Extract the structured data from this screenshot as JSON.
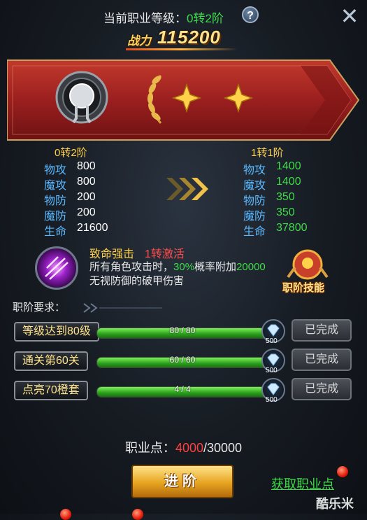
{
  "header": {
    "title_prefix": "当前职业等级：",
    "title_stage": "0转2阶",
    "power_label": "战力",
    "power_value": "115200"
  },
  "stats": {
    "current": {
      "stage": "0转2阶",
      "rows": [
        {
          "label": "物攻",
          "value": "800"
        },
        {
          "label": "魔攻",
          "value": "800"
        },
        {
          "label": "物防",
          "value": "200"
        },
        {
          "label": "魔防",
          "value": "200"
        },
        {
          "label": "生命",
          "value": "21600"
        }
      ]
    },
    "next": {
      "stage": "1转1阶",
      "rows": [
        {
          "label": "物攻",
          "value": "1400"
        },
        {
          "label": "魔攻",
          "value": "1400"
        },
        {
          "label": "物防",
          "value": "350"
        },
        {
          "label": "魔防",
          "value": "350"
        },
        {
          "label": "生命",
          "value": "37800"
        }
      ]
    }
  },
  "skill": {
    "name": "致命强击",
    "unlock": "1转激活",
    "desc_1": "所有角色攻击时，",
    "desc_pct": "30%",
    "desc_2": "概率附加",
    "desc_num": "20000",
    "desc_3": "无视防御的破甲伤害",
    "badge_label": "职阶技能"
  },
  "requirements": {
    "title": "职阶要求：",
    "items": [
      {
        "label": "等级达到80级",
        "progress_text": "80 / 80",
        "progress": 1.0,
        "gem_count": "500",
        "status": "已完成"
      },
      {
        "label": "通关第60关",
        "progress_text": "60 / 60",
        "progress": 1.0,
        "gem_count": "500",
        "status": "已完成"
      },
      {
        "label": "点亮70橙套",
        "progress_text": "4 / 4",
        "progress": 1.0,
        "gem_count": "500",
        "status": "已完成"
      }
    ]
  },
  "footer": {
    "points_label": "职业点：",
    "points_current": "4000",
    "points_sep": "/",
    "points_total": "30000",
    "advance_label": "进阶",
    "get_points_label": "获取职业点",
    "watermark": "酷乐米"
  },
  "colors": {
    "accent_green": "#3fdc4a",
    "highlight_red": "#ff4040",
    "gold": "#ffd24a",
    "stat_blue": "#5ab8ff",
    "banner_red": "#9b1f1f"
  }
}
